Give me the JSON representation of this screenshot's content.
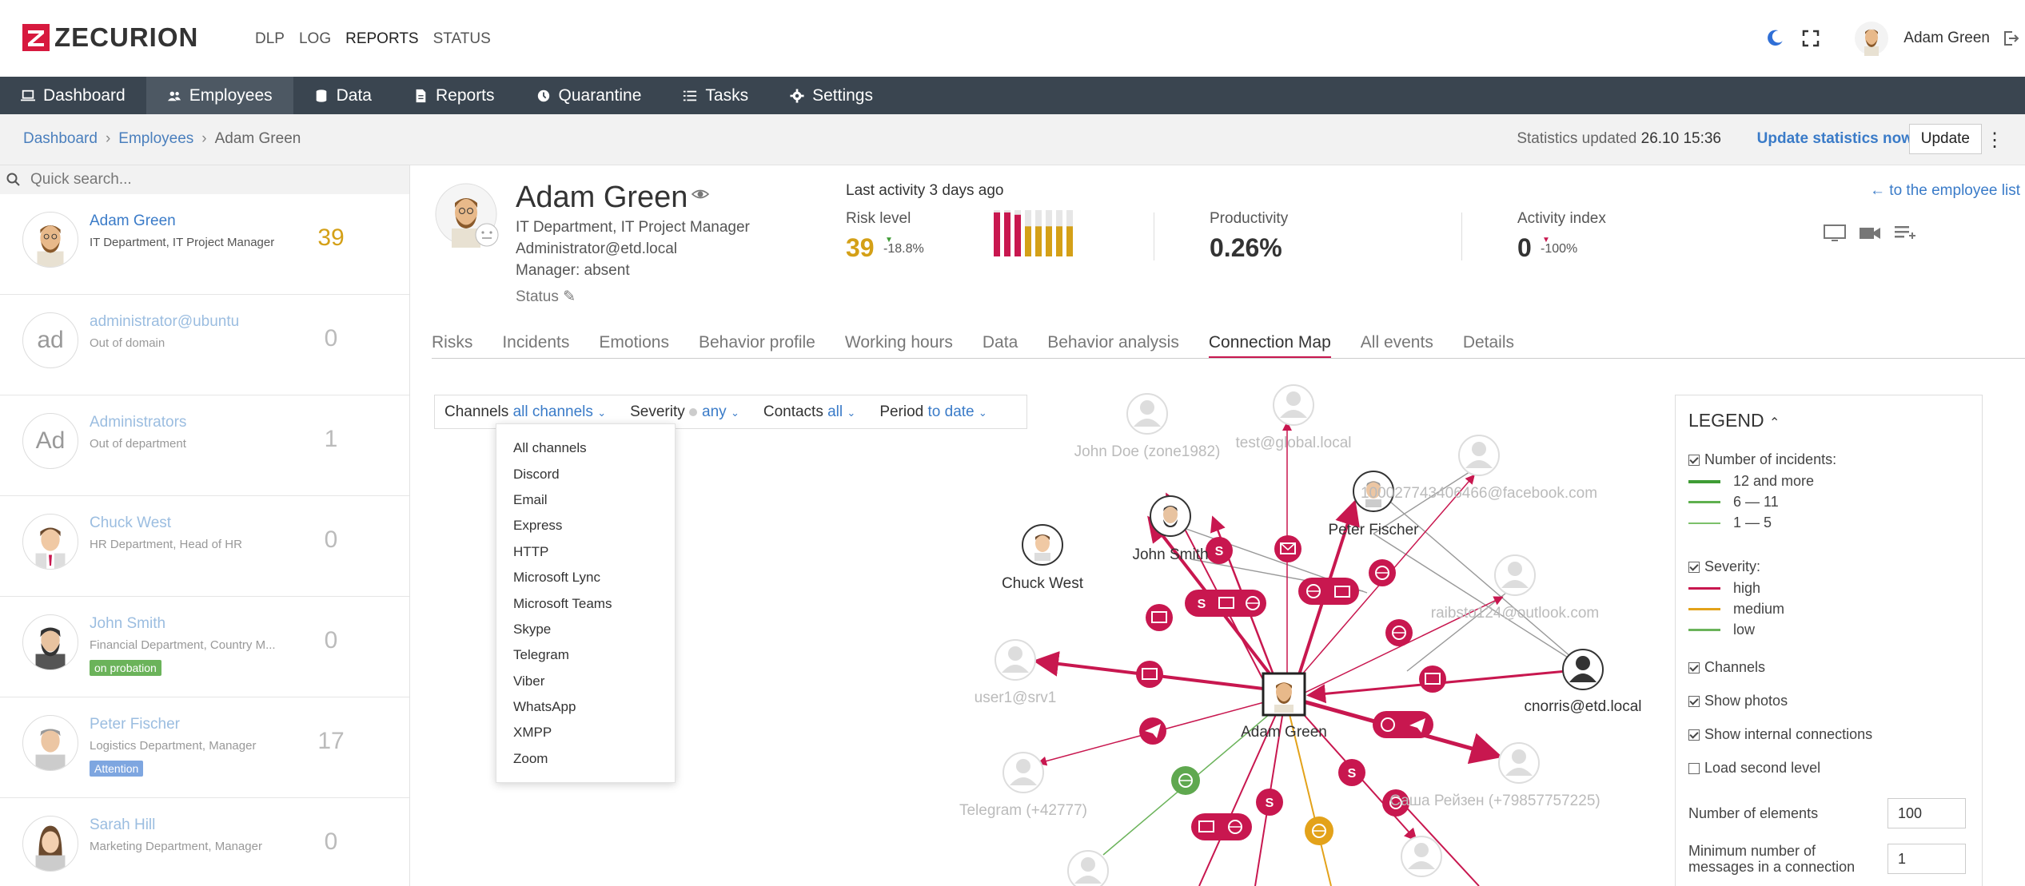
{
  "brand": {
    "name": "ZECURION",
    "color": "#d7193e"
  },
  "topnav": [
    "DLP",
    "LOG",
    "REPORTS",
    "STATUS"
  ],
  "user": {
    "name": "Adam Green"
  },
  "mainnav": [
    {
      "label": "Dashboard",
      "icon": "laptop-icon"
    },
    {
      "label": "Employees",
      "icon": "users-icon"
    },
    {
      "label": "Data",
      "icon": "database-icon"
    },
    {
      "label": "Reports",
      "icon": "report-icon"
    },
    {
      "label": "Quarantine",
      "icon": "clock-icon"
    },
    {
      "label": "Tasks",
      "icon": "list-icon"
    },
    {
      "label": "Settings",
      "icon": "gear-icon"
    }
  ],
  "breadcrumb": [
    "Dashboard",
    "Employees",
    "Adam Green"
  ],
  "stats": {
    "label": "Statistics updated",
    "date": "26.10 15:36",
    "update_now": "Update statistics now",
    "update": "Update"
  },
  "search": {
    "placeholder": "Quick search..."
  },
  "employees": [
    {
      "name": "Adam Green",
      "dept": "IT Department, IT Project Manager",
      "score": "39",
      "initials": "",
      "tag": ""
    },
    {
      "name": "administrator@ubuntu",
      "dept": "Out of domain",
      "score": "0",
      "initials": "ad",
      "tag": ""
    },
    {
      "name": "Administrators",
      "dept": "Out of department",
      "score": "1",
      "initials": "Ad",
      "tag": ""
    },
    {
      "name": "Chuck West",
      "dept": "HR Department, Head of HR",
      "score": "0",
      "initials": "",
      "tag": ""
    },
    {
      "name": "John Smith",
      "dept": "Financial Department, Country M...",
      "score": "0",
      "initials": "",
      "tag": "on probation"
    },
    {
      "name": "Peter Fischer",
      "dept": "Logistics Department, Manager",
      "score": "17",
      "initials": "",
      "tag": "Attention"
    },
    {
      "name": "Sarah Hill",
      "dept": "Marketing Department, Manager",
      "score": "0",
      "initials": "",
      "tag": ""
    }
  ],
  "profile": {
    "name": "Adam Green",
    "dept": "IT Department, IT Project Manager",
    "email": "Administrator@etd.local",
    "manager": "Manager: absent",
    "status": "Status",
    "last_activity": "Last activity 3 days ago",
    "risk": {
      "label": "Risk level",
      "value": "39",
      "delta": "-18.8%"
    },
    "productivity": {
      "label": "Productivity",
      "value": "0.26%"
    },
    "activity": {
      "label": "Activity index",
      "value": "0",
      "delta": "-100%"
    },
    "to_list": "← to the employee list",
    "risk_bars": [
      {
        "v": 0.95,
        "c": "#c8174f"
      },
      {
        "v": 0.95,
        "c": "#c8174f"
      },
      {
        "v": 0.9,
        "c": "#c8174f"
      },
      {
        "v": 0.65,
        "c": "#d4a017"
      },
      {
        "v": 0.65,
        "c": "#d4a017"
      },
      {
        "v": 0.65,
        "c": "#d4a017"
      },
      {
        "v": 0.65,
        "c": "#d4a017"
      },
      {
        "v": 0.65,
        "c": "#d4a017"
      }
    ]
  },
  "tabs": [
    "Risks",
    "Incidents",
    "Emotions",
    "Behavior profile",
    "Working hours",
    "Data",
    "Behavior analysis",
    "Connection Map",
    "All events",
    "Details"
  ],
  "active_tab": "Connection Map",
  "filters": {
    "channels_label": "Channels",
    "channels_value": "all channels",
    "severity_label": "Severity",
    "severity_value": "any",
    "contacts_label": "Contacts",
    "contacts_value": "all",
    "period_label": "Period",
    "period_value": "to date"
  },
  "channel_options": [
    "All channels",
    "Discord",
    "Email",
    "Express",
    "HTTP",
    "Microsoft Lync",
    "Microsoft Teams",
    "Skype",
    "Telegram",
    "Viber",
    "WhatsApp",
    "XMPP",
    "Zoom"
  ],
  "map_labels": {
    "center": "Adam Green",
    "chuck": "Chuck West",
    "john": "John Smith",
    "peter": "Peter Fischer",
    "cnorris": "cnorris@etd.local",
    "johndoe": "John Doe (zone1982)",
    "test": "test@global.local",
    "facebook": "100027743406466@facebook.com",
    "outlook": "raibsto124@outlook.com",
    "user1": "user1@srv1",
    "telegram": "Telegram (+42777)",
    "sasha": "Саша Рейзен (+79857757225)"
  },
  "legend": {
    "title": "LEGEND",
    "incidents_label": "Number of incidents:",
    "incidents": [
      {
        "label": "12 and more",
        "color": "#3f9c35"
      },
      {
        "label": "6 — 11",
        "color": "#5fb04f"
      },
      {
        "label": "1 — 5",
        "color": "#7cc06a"
      }
    ],
    "severity_label": "Severity:",
    "severity": [
      {
        "label": "high",
        "color": "#c8174f"
      },
      {
        "label": "medium",
        "color": "#e3a21a"
      },
      {
        "label": "low",
        "color": "#6bb35a"
      }
    ],
    "channels": "Channels",
    "photos": "Show photos",
    "internal": "Show internal connections",
    "second": "Load second level",
    "elements_label": "Number of elements",
    "elements_value": "100",
    "min_label": "Minimum number of messages in a connection",
    "min_value": "1"
  }
}
